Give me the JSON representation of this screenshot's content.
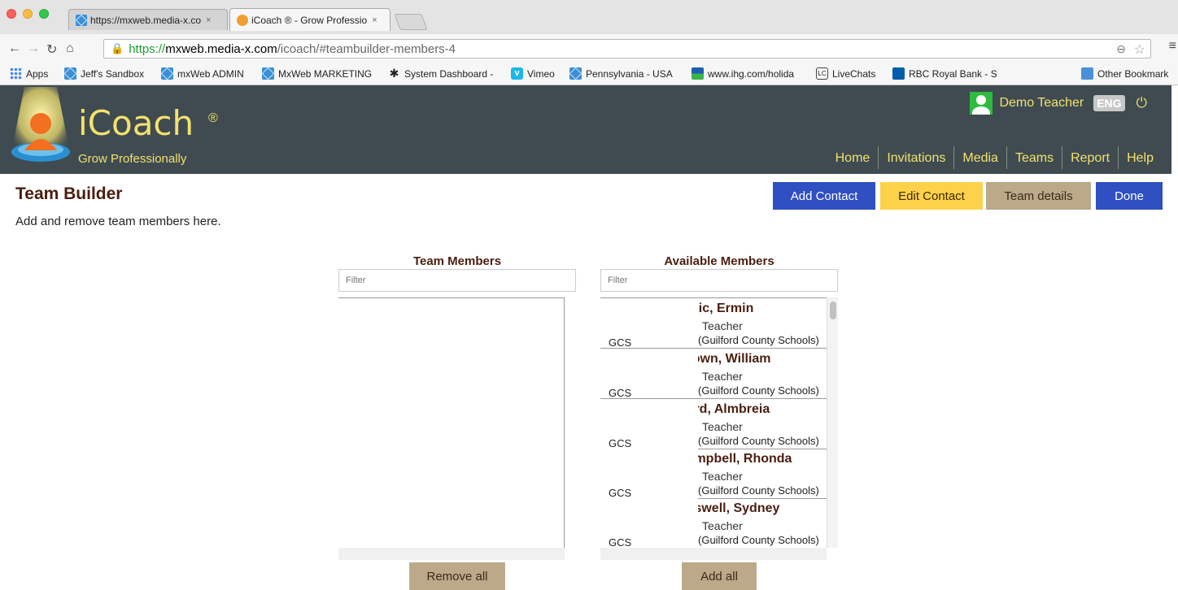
{
  "browser": {
    "tabs": [
      {
        "title": "https://mxweb.media-x.co",
        "close": "×"
      },
      {
        "title": "iCoach ® - Grow Professio",
        "close": "×"
      }
    ],
    "url": {
      "scheme": "https://",
      "host": "mxweb.media-x.com",
      "path": "/icoach/#teambuilder-members-4"
    },
    "bookmarks": [
      {
        "label": "Apps",
        "icon": "apps-grid-icon"
      },
      {
        "label": "Jeff's Sandbox",
        "icon": "mx-icon"
      },
      {
        "label": "mxWeb ADMIN",
        "icon": "mx-icon"
      },
      {
        "label": "MxWeb MARKETING",
        "icon": "mx-icon"
      },
      {
        "label": "System Dashboard -",
        "icon": "system-icon"
      },
      {
        "label": "Vimeo",
        "icon": "vimeo-icon"
      },
      {
        "label": "Pennsylvania - USA",
        "icon": "mx-icon"
      },
      {
        "label": "www.ihg.com/holida",
        "icon": "ihg-icon"
      },
      {
        "label": "LiveChats",
        "icon": "lc-icon"
      },
      {
        "label": "RBC Royal Bank - S",
        "icon": "rbc-icon"
      },
      {
        "label": "Other Bookmark",
        "icon": "folder-icon"
      }
    ]
  },
  "header": {
    "brand": "iCoach",
    "registered": "®",
    "tagline": "Grow Professionally",
    "user_name": "Demo Teacher",
    "lang": "ENG",
    "nav": [
      "Home",
      "Invitations",
      "Media",
      "Teams",
      "Report",
      "Help"
    ]
  },
  "page": {
    "title": "Team Builder",
    "subtitle": "Add and remove team members here.",
    "buttons": {
      "add_contact": "Add Contact",
      "edit_contact": "Edit Contact",
      "team_details": "Team details",
      "done": "Done"
    }
  },
  "team_members": {
    "title": "Team Members",
    "filter_placeholder": "Filter",
    "remove_all": "Remove all"
  },
  "available_members": {
    "title": "Available Members",
    "filter_placeholder": "Filter",
    "add_all": "Add all",
    "items": [
      {
        "name": "Bibic, Ermin",
        "role": "Teacher",
        "school": "(Guilford County Schools)",
        "code": "GCS"
      },
      {
        "name": "Brown, William",
        "role": "Teacher",
        "school": "(Guilford County Schools)",
        "code": "GCS"
      },
      {
        "name": "Byrd, Almbreia",
        "role": "Teacher",
        "school": "(Guilford County Schools)",
        "code": "GCS"
      },
      {
        "name": "Campbell, Rhonda",
        "role": "Teacher",
        "school": "(Guilford County Schools)",
        "code": "GCS"
      },
      {
        "name": "Caswell, Sydney",
        "role": "Teacher",
        "school": "(Guilford County Schools)",
        "code": "GCS"
      }
    ]
  },
  "colors": {
    "header_bg": "#3f4b50",
    "brand_yellow": "#f3e16d",
    "primary_blue": "#2f4fc2",
    "warning_yellow": "#fdd14a",
    "tan": "#bca98a",
    "title_brown": "#4a1e10"
  }
}
